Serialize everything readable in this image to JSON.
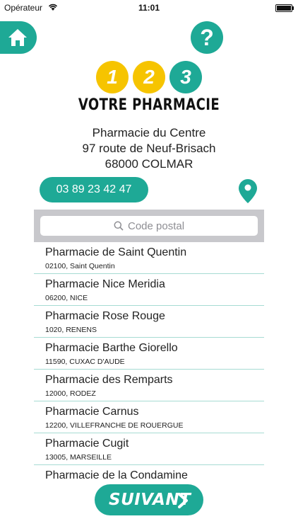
{
  "status_bar": {
    "carrier": "Opérateur",
    "time": "11:01"
  },
  "header": {
    "home_icon": "home-icon",
    "help_icon": "question-icon",
    "help_glyph": "?"
  },
  "logo": {
    "digits": [
      "1",
      "2",
      "3"
    ],
    "title": "VOTRE PHARMACIE"
  },
  "pharmacy": {
    "name": "Pharmacie du Centre",
    "street": "97 route de Neuf-Brisach",
    "city": "68000 COLMAR",
    "phone": "03 89 23 42 47"
  },
  "search": {
    "placeholder": "Code postal",
    "value": ""
  },
  "list": [
    {
      "name": "Pharmacie de Saint Quentin",
      "location": "02100, Saint Quentin"
    },
    {
      "name": "Pharmacie Nice Meridia",
      "location": "06200, NICE"
    },
    {
      "name": "Pharmacie Rose Rouge",
      "location": "1020, RENENS"
    },
    {
      "name": "Pharmacie Barthe Giorello",
      "location": "11590, CUXAC D'AUDE"
    },
    {
      "name": "Pharmacie des Remparts",
      "location": "12000, RODEZ"
    },
    {
      "name": "Pharmacie Carnus",
      "location": "12200, VILLEFRANCHE DE ROUERGUE"
    },
    {
      "name": "Pharmacie Cugit",
      "location": "13005, MARSEILLE"
    },
    {
      "name": "Pharmacie de la Condamine",
      "location": ""
    }
  ],
  "footer": {
    "next_label": "SUIVANT"
  },
  "colors": {
    "accent": "#1ea996",
    "yellow": "#f6c400",
    "separator": "#a6dbd3"
  }
}
